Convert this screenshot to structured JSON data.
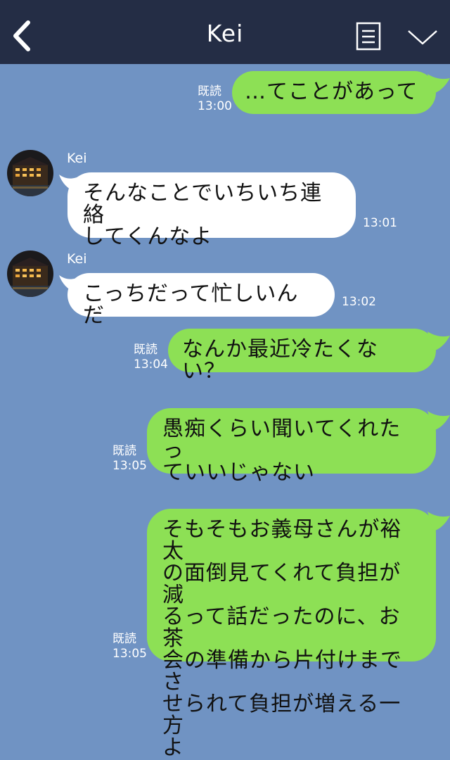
{
  "header": {
    "title": "Kei",
    "back_icon": "chevron-left-icon",
    "notes_icon": "notes-icon",
    "menu_icon": "chevron-down-icon",
    "background": "#242d45"
  },
  "chat": {
    "background": "#7093c3",
    "sent_bubble_color": "#8de055",
    "received_bubble_color": "#ffffff",
    "messages": [
      {
        "from": "me",
        "lines": [
          "…てことがあって"
        ],
        "read": "既読",
        "time": "13:00"
      },
      {
        "from": "Kei",
        "sender": "Kei",
        "lines": [
          "そんなことでいちいち連絡",
          "してくんなよ"
        ],
        "time": "13:01"
      },
      {
        "from": "Kei",
        "sender": "Kei",
        "lines": [
          "こっちだって忙しいんだ"
        ],
        "time": "13:02"
      },
      {
        "from": "me",
        "lines": [
          "なんか最近冷たくない？"
        ],
        "read": "既読",
        "time": "13:04"
      },
      {
        "from": "me",
        "lines": [
          "愚痴くらい聞いてくれたっ",
          "ていいじゃない"
        ],
        "read": "既読",
        "time": "13:05"
      },
      {
        "from": "me",
        "lines": [
          "そもそもお義母さんが裕太",
          "の面倒見てくれて負担が減",
          "るって話だったのに、お茶",
          "会の準備から片付けまでさ",
          "せられて負担が増える一方",
          "よ"
        ],
        "read": "既読",
        "time": "13:05"
      }
    ]
  }
}
